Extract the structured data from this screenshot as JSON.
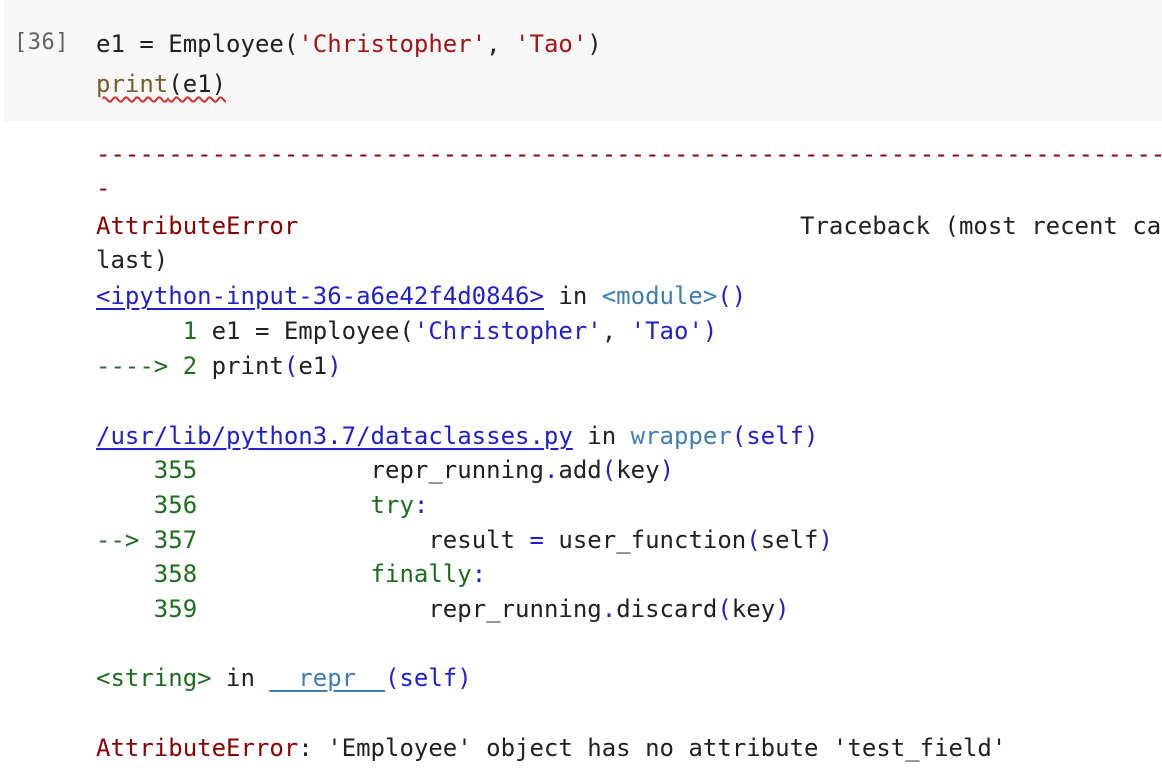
{
  "cell": {
    "exec_count": "[36]",
    "code": {
      "line1": {
        "pre": "e1 = Employee(",
        "arg1": "'Christopher'",
        "sep": ", ",
        "arg2": "'Tao'",
        "post": ")"
      },
      "line2": {
        "fn": "print",
        "args": "(e1)"
      }
    }
  },
  "output": {
    "dashes": "---------------------------------------------------------------------------",
    "dash2": "-",
    "error_name": "AttributeError",
    "traceback_label": "Traceback (most recent call",
    "traceback_label_cont": "last)",
    "frame1": {
      "link": "<ipython-input-36-a6e42f4d0846>",
      "in": " in ",
      "scope": "<module>",
      "parens": "()",
      "lines": [
        {
          "prefix": "      1",
          "code_pre": " e1 = Employee(",
          "s1": "'Christopher'",
          "sep": ", ",
          "s2": "'Tao'",
          "code_post": ")"
        },
        {
          "prefix": "----> 2",
          "code_pre": " print",
          "p_open": "(",
          "arg": "e1",
          "p_close": ")"
        }
      ]
    },
    "frame2": {
      "link": "/usr/lib/python3.7/dataclasses.py",
      "in": " in ",
      "scope": "wrapper",
      "args": "(self)",
      "lines": [
        {
          "prefix": "    355",
          "code": "            repr_running",
          "dot": ".",
          "rest": "add",
          "po": "(",
          "arg": "key",
          "pc": ")"
        },
        {
          "prefix": "    356",
          "kw": "            try",
          "colon": ":"
        },
        {
          "prefix": "--> 357",
          "code": "                result ",
          "eq": "=",
          "rest": " user_function",
          "po": "(",
          "arg": "self",
          "pc": ")"
        },
        {
          "prefix": "    358",
          "kw": "            finally",
          "colon": ":"
        },
        {
          "prefix": "    359",
          "code": "                repr_running",
          "dot": ".",
          "rest": "discard",
          "po": "(",
          "arg": "key",
          "pc": ")"
        }
      ]
    },
    "frame3": {
      "tag": "<string>",
      "in": " in ",
      "scope": "__repr__",
      "args": "(self)"
    },
    "final_error": {
      "name": "AttributeError",
      "message": ": 'Employee' object has no attribute 'test_field'"
    }
  }
}
